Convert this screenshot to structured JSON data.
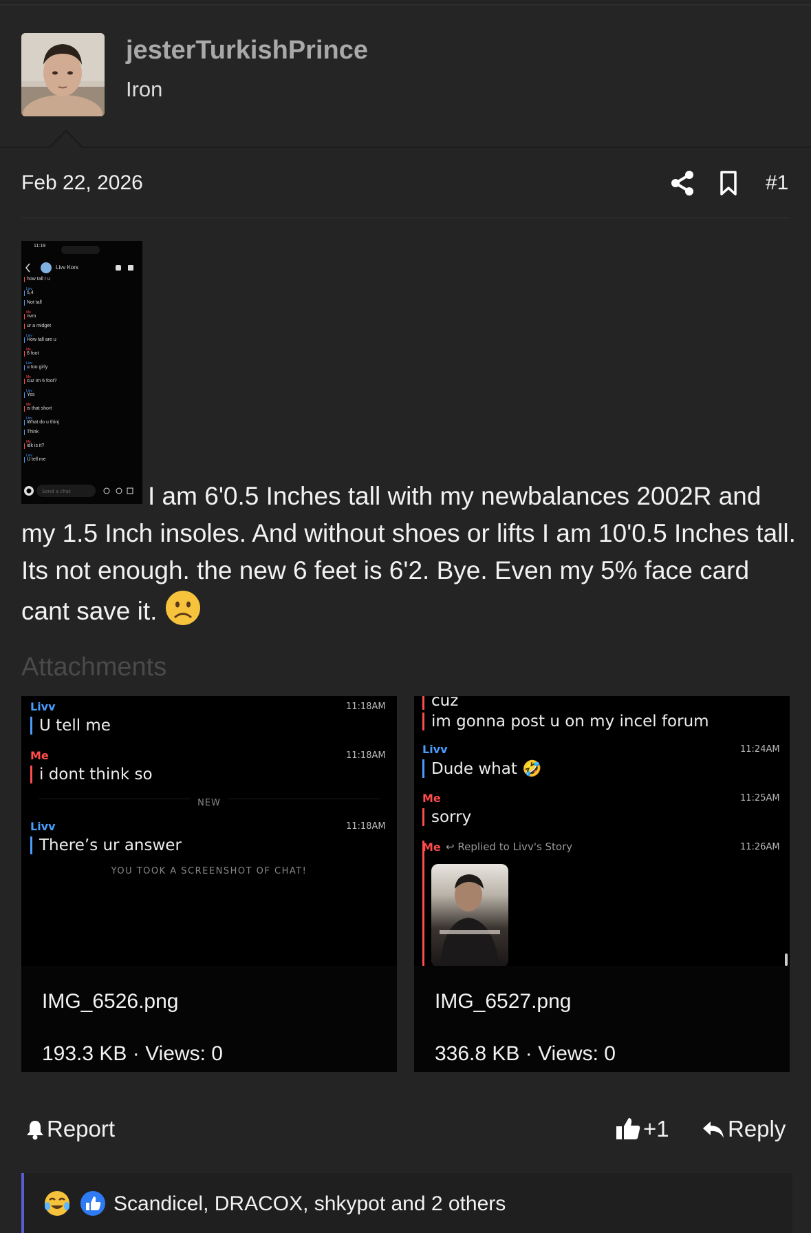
{
  "user": {
    "username": "jesterTurkishPrince",
    "title": "Iron"
  },
  "post": {
    "date": "Feb 22, 2026",
    "number": "#1",
    "body": "I am 6'0.5 Inches tall with my newbalances 2002R and my 1.5 Inch insoles. And without shoes or lifts I am 10'0.5 Inches tall. Its not enough. the new 6 feet is 6'2. Bye. Even my 5% face card cant save it.",
    "inline_image": {
      "status_time": "11:19",
      "contact": "Livv Kors",
      "messages": [
        {
          "who": "",
          "text": "how tall r u"
        },
        {
          "who": "Livv",
          "text": "5,4"
        },
        {
          "who": "",
          "text": "Not tall"
        },
        {
          "who": "Me",
          "text": "nvm"
        },
        {
          "who": "",
          "text": "ur a midget"
        },
        {
          "who": "Livv",
          "text": "How tall are u"
        },
        {
          "who": "Me",
          "text": "6 foot"
        },
        {
          "who": "Livv",
          "text": "u too girly"
        },
        {
          "who": "Me",
          "text": "cuz im 6 foot?"
        },
        {
          "who": "Livv",
          "text": "Yes"
        },
        {
          "who": "Me",
          "text": "is that short"
        },
        {
          "who": "Livv",
          "text": "What do u thinj"
        },
        {
          "who": "",
          "text": "Think"
        },
        {
          "who": "Me",
          "text": "idk is it?"
        },
        {
          "who": "Livv",
          "text": "U tell me"
        }
      ],
      "input_placeholder": "Send a chat"
    }
  },
  "attachments": {
    "title": "Attachments",
    "items": [
      {
        "filename": "IMG_6526.png",
        "meta": "193.3 KB · Views: 0",
        "screen": {
          "m1_who": "Livv",
          "m1_time": "11:18AM",
          "m1_text": "U tell me",
          "m2_who": "Me",
          "m2_time": "11:18AM",
          "m2_text": "i dont think so",
          "new_label": "NEW",
          "m3_who": "Livv",
          "m3_time": "11:18AM",
          "m3_text": "There’s ur answer",
          "note": "YOU TOOK A SCREENSHOT OF CHAT!"
        }
      },
      {
        "filename": "IMG_6527.png",
        "meta": "336.8 KB · Views: 0",
        "screen": {
          "m0_text": "cuz",
          "m0b_text": "im gonna post u on my incel forum",
          "m1_who": "Livv",
          "m1_time": "11:24AM",
          "m1_text": "Dude what 🤣",
          "m2_who": "Me",
          "m2_time": "11:25AM",
          "m2_text": "sorry",
          "m3_who": "Me",
          "m3_reply": "Replied to Livv's Story",
          "m3_time": "11:26AM"
        }
      }
    ]
  },
  "actions": {
    "report": "Report",
    "like": "+1",
    "reply": "Reply"
  },
  "reactions": {
    "names": "Scandicel, DRACOX, shkypot and 2 others"
  },
  "colors": {
    "background": "#242424",
    "username": "#a9a9a9",
    "accent": "#5b5bd6",
    "livv_blue": "#4a9eff",
    "me_red": "#ff4d4d"
  }
}
